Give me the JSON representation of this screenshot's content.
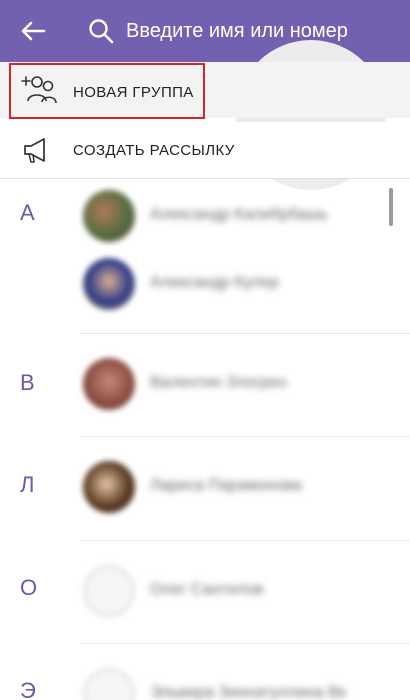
{
  "header": {
    "search_placeholder": "Введите имя или номер",
    "background_color": "#7360b0",
    "icons": {
      "back": "arrow-left-icon",
      "search": "search-icon"
    }
  },
  "actions": {
    "new_group_label": "НОВАЯ ГРУППА",
    "broadcast_label": "СОЗДАТЬ РАССЫЛКУ",
    "icons": {
      "new_group": "add-group-icon",
      "broadcast": "megaphone-icon"
    },
    "highlight_color": "#d8232a"
  },
  "contacts": {
    "sections": [
      {
        "letter": "А",
        "names": [
          "Александр Калибрбашь",
          "Александр Кулер"
        ]
      },
      {
        "letter": "В",
        "names": [
          "Валентин Злогрен"
        ]
      },
      {
        "letter": "Л",
        "names": [
          "Лариса Парамонова"
        ]
      },
      {
        "letter": "О",
        "names": [
          "Олег Сантилов"
        ]
      },
      {
        "letter": "Э",
        "names": [
          "Эльвира Зиннатуллина Вк"
        ]
      }
    ],
    "letter_color": "#6a5aa8"
  }
}
